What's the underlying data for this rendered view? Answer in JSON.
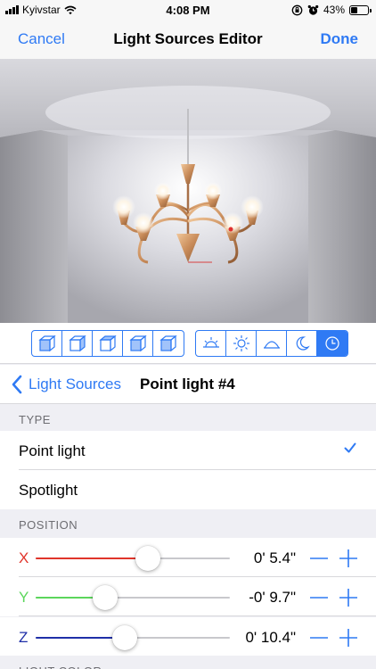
{
  "status": {
    "carrier": "Kyivstar",
    "time": "4:08 PM",
    "battery": "43%",
    "battery_level": 0.43
  },
  "nav": {
    "cancel": "Cancel",
    "title": "Light Sources Editor",
    "done": "Done"
  },
  "toolbar": {
    "view_icons": [
      "cube-front-icon",
      "cube-left-icon",
      "cube-top-icon",
      "cube-right-icon",
      "cube-back-icon"
    ],
    "light_icons": [
      "sunrise-icon",
      "sun-icon",
      "dome-icon",
      "moon-icon",
      "clock-icon"
    ],
    "active_light_index": 4
  },
  "subheader": {
    "back_label": "Light Sources",
    "title": "Point light #4"
  },
  "type_section": {
    "header": "TYPE",
    "options": [
      {
        "label": "Point light",
        "selected": true
      },
      {
        "label": "Spotlight",
        "selected": false
      }
    ]
  },
  "position_section": {
    "header": "POSITION",
    "axes": [
      {
        "axis": "X",
        "value": "0' 5.4\"",
        "level": 0.58,
        "color": "#e0352b"
      },
      {
        "axis": "Y",
        "value": "-0' 9.7\"",
        "level": 0.36,
        "color": "#5cd65c"
      },
      {
        "axis": "Z",
        "value": "0' 10.4\"",
        "level": 0.46,
        "color": "#1f2fa8"
      }
    ]
  },
  "next_section": {
    "header": "LIGHT COLOR"
  },
  "colors": {
    "accent": "#2f7af4"
  }
}
